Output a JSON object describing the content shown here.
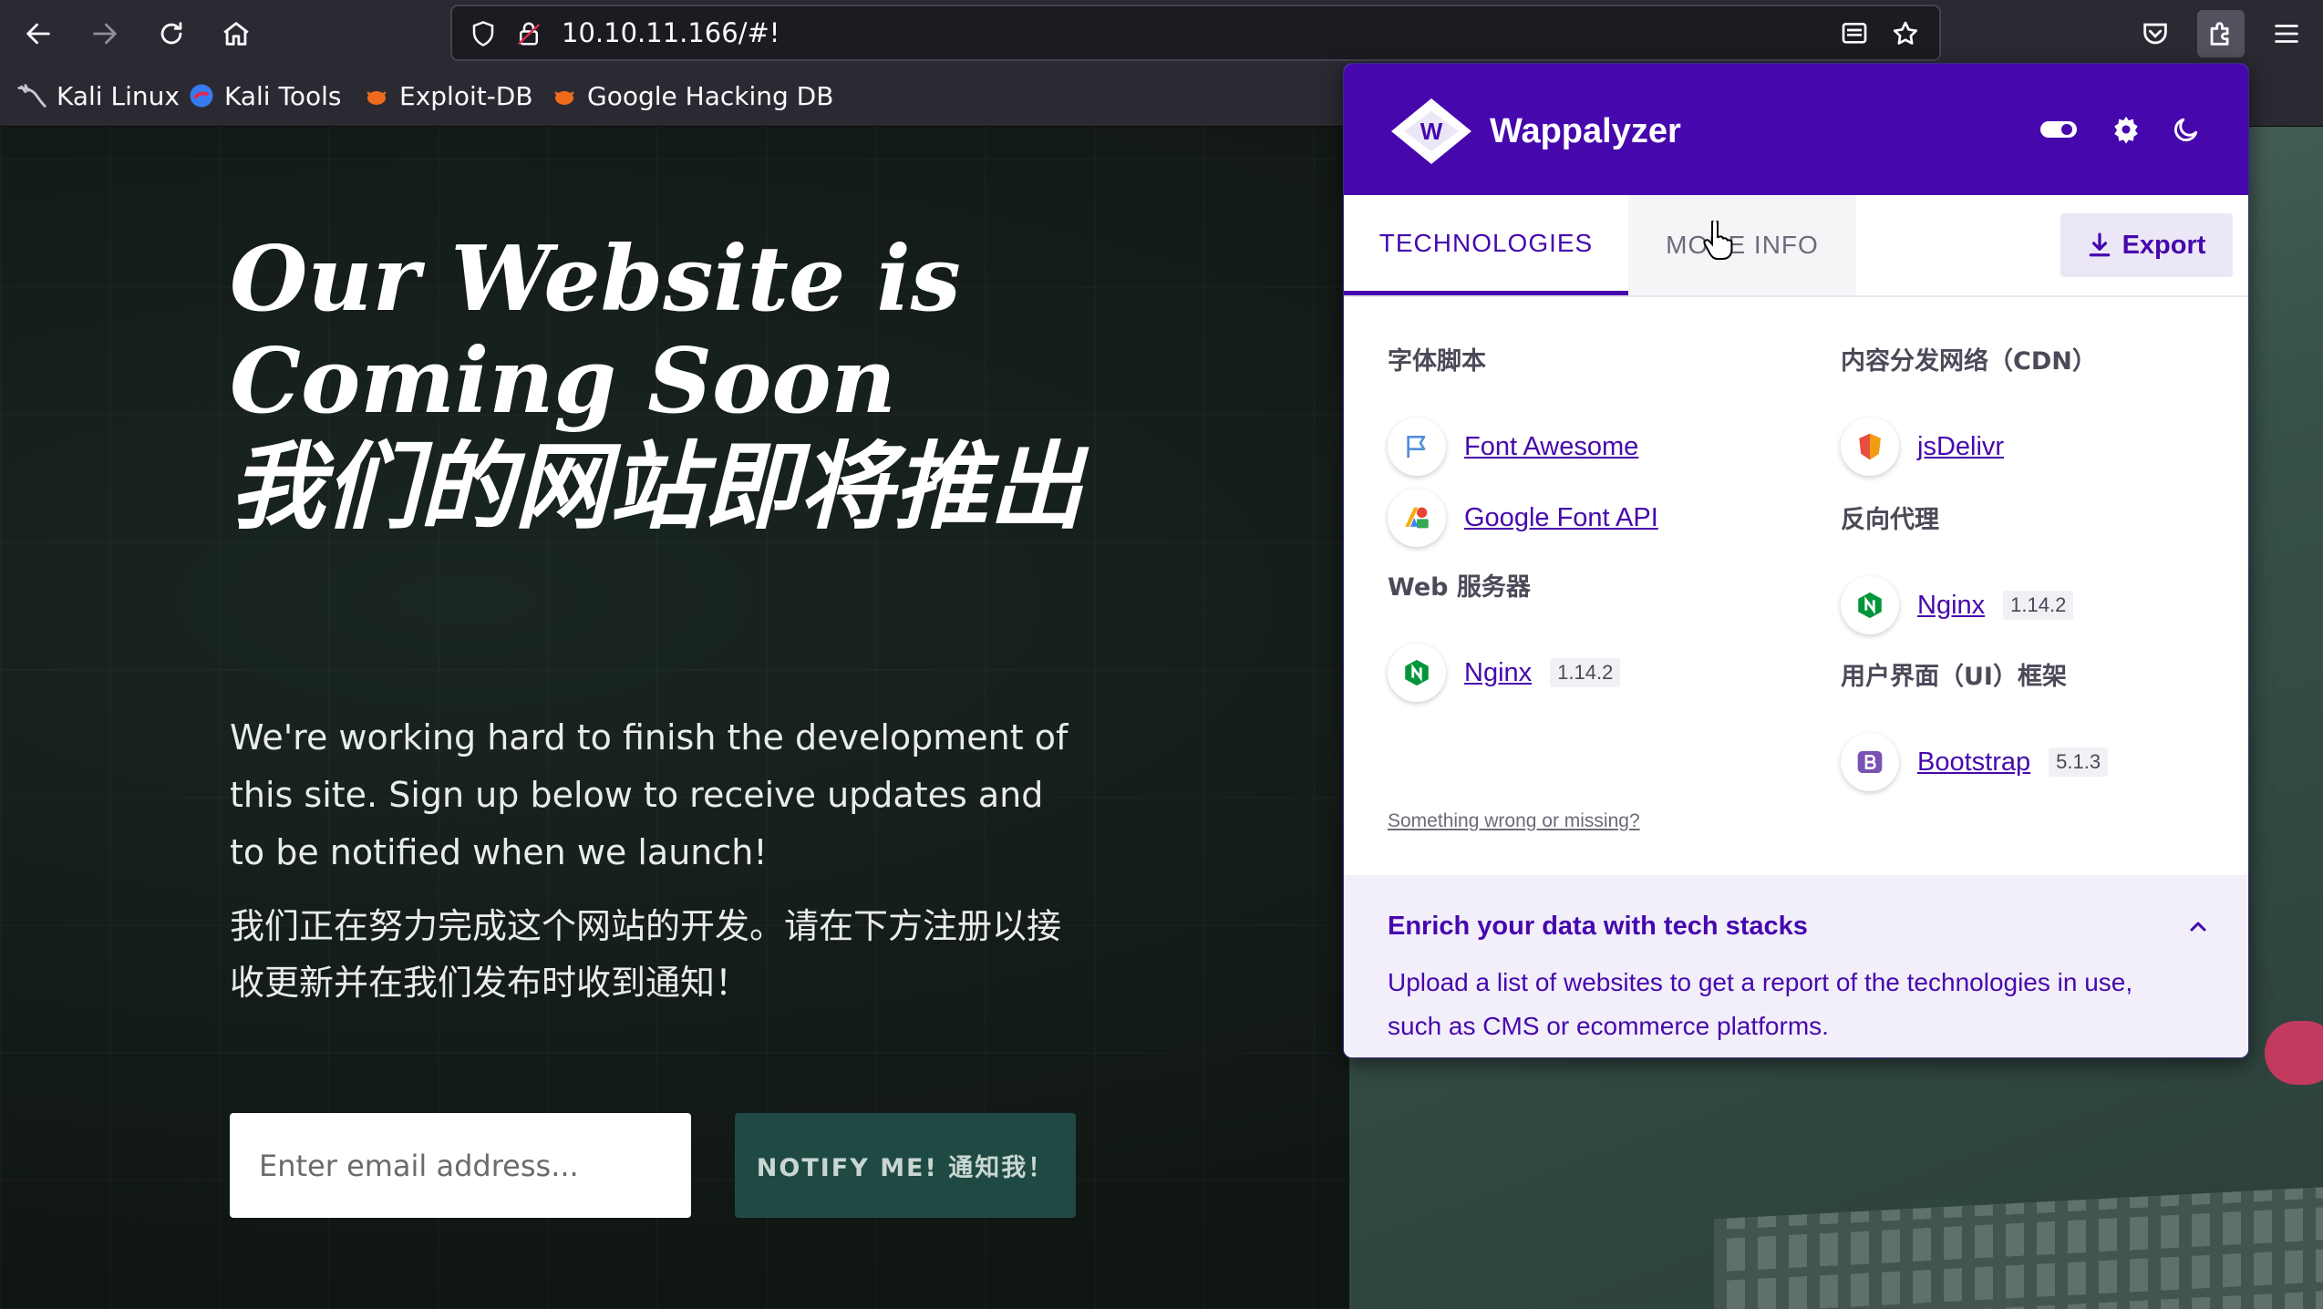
{
  "browser": {
    "url": "10.10.11.166/#!",
    "bookmarks": [
      {
        "label": "Kali Linux"
      },
      {
        "label": "Kali Tools"
      },
      {
        "label": "Exploit-DB"
      },
      {
        "label": "Google Hacking DB"
      }
    ]
  },
  "page": {
    "title_line1": "Our Website is",
    "title_line2": "Coming Soon",
    "title_cn": "我们的网站即将推出",
    "paragraph": "We're working hard to finish the development of this site. Sign up below to receive updates and to be notified when we launch!",
    "paragraph_cn": "我们正在努力完成这个网站的开发。请在下方注册以接收更新并在我们发布时收到通知！",
    "email_placeholder": "Enter email address...",
    "notify_label": "NOTIFY ME! 通知我！"
  },
  "wappalyzer": {
    "brand": "Wappalyzer",
    "tabs": [
      {
        "label": "TECHNOLOGIES"
      },
      {
        "label": "MORE INFO"
      }
    ],
    "export_label": "Export",
    "categories_left": [
      {
        "name": "字体脚本",
        "techs": [
          {
            "name": "Font Awesome",
            "version": "",
            "icon": "font-awesome-flag-icon"
          },
          {
            "name": "Google Font API",
            "version": "",
            "icon": "google-font-api-icon"
          }
        ]
      },
      {
        "name": "Web 服务器",
        "techs": [
          {
            "name": "Nginx",
            "version": "1.14.2",
            "icon": "nginx-icon"
          }
        ]
      }
    ],
    "categories_right": [
      {
        "name": "内容分发网络（CDN）",
        "techs": [
          {
            "name": "jsDelivr",
            "version": "",
            "icon": "jsdelivr-icon"
          }
        ]
      },
      {
        "name": "反向代理",
        "techs": [
          {
            "name": "Nginx",
            "version": "1.14.2",
            "icon": "nginx-icon"
          }
        ]
      },
      {
        "name": "用户界面（UI）框架",
        "techs": [
          {
            "name": "Bootstrap",
            "version": "5.1.3",
            "icon": "bootstrap-icon"
          }
        ]
      }
    ],
    "wrong_link": "Something wrong or missing?",
    "enrich_title": "Enrich your data with tech stacks",
    "enrich_body": "Upload a list of websites to get a report of the technologies in use, such as CMS or ecommerce platforms."
  },
  "colors": {
    "wappalyzer_purple": "#4608ad",
    "notify_button": "#1f4a44"
  }
}
